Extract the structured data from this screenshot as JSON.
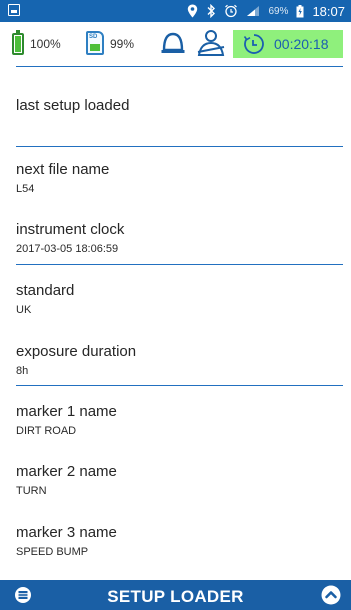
{
  "status_bar": {
    "battery_percent": "69%",
    "time": "18:07",
    "icons": [
      "screenshot-icon",
      "location-icon",
      "bluetooth-icon",
      "alarm-icon",
      "signal-icon",
      "battery-charging-icon"
    ]
  },
  "info_bar": {
    "battery_label": "100%",
    "battery_level": 1.0,
    "sd_label": "99%",
    "sd_card_text": "SD",
    "timer": "00:20:18",
    "colors": {
      "timer_bg": "#8ff07c",
      "battery_green": "#4cbf3a",
      "accent_blue": "#1665b0"
    }
  },
  "settings": [
    {
      "label": "last setup loaded",
      "value": ""
    },
    {
      "label": "next file name",
      "value": "L54"
    },
    {
      "label": "instrument clock",
      "value": "2017-03-05 18:06:59"
    },
    {
      "label": "standard",
      "value": "UK"
    },
    {
      "label": "exposure duration",
      "value": "8h"
    },
    {
      "label": "marker 1 name",
      "value": "DIRT ROAD"
    },
    {
      "label": "marker 2 name",
      "value": "TURN"
    },
    {
      "label": "marker 3 name",
      "value": "SPEED BUMP"
    }
  ],
  "bottom_bar": {
    "title": "SETUP LOADER",
    "icons": [
      "setup-loader-icon",
      "chevron-up-icon"
    ]
  }
}
